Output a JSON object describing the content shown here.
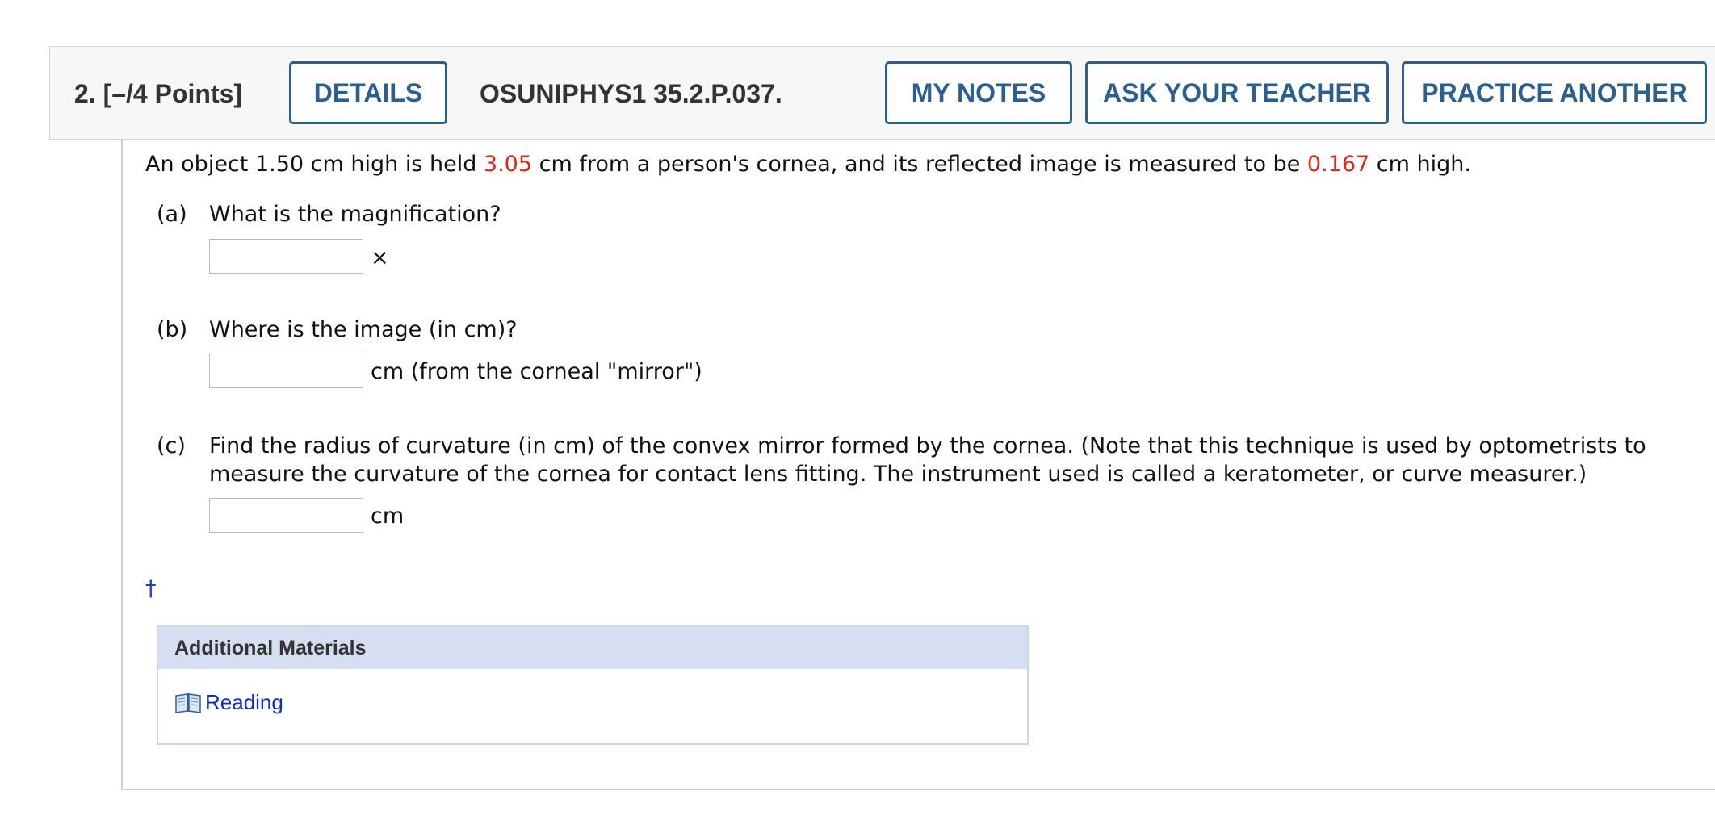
{
  "header": {
    "question_number": "2.",
    "points": "[–/4 Points]",
    "details_label": "DETAILS",
    "problem_code": "OSUNIPHYS1 35.2.P.037.",
    "my_notes_label": "MY NOTES",
    "ask_teacher_label": "ASK YOUR TEACHER",
    "practice_another_label": "PRACTICE ANOTHER"
  },
  "problem": {
    "statement_part1": "An object 1.50 cm high is held ",
    "value1": "3.05",
    "statement_part2": " cm from a person's cornea, and its reflected image is measured to be ",
    "value2": "0.167",
    "statement_part3": " cm high.",
    "highlight_color": "#e3261c"
  },
  "parts": [
    {
      "label": "(a)",
      "question": "What is the magnification?",
      "answer_value": "",
      "unit": "×"
    },
    {
      "label": "(b)",
      "question": "Where is the image (in cm)?",
      "answer_value": "",
      "unit": "cm (from the corneal \"mirror\")"
    },
    {
      "label": "(c)",
      "question_line1": "Find the radius of curvature (in cm) of the convex mirror formed by the cornea. (Note that this technique is used by optometrists to",
      "question_line2": "measure the curvature of the cornea for contact lens fitting. The instrument used is called a keratometer, or curve measurer.)",
      "answer_value": "",
      "unit": "cm"
    }
  ],
  "footnote_symbol": "†",
  "additional_materials": {
    "title": "Additional Materials",
    "link_icon": "book-icon",
    "link_label": "Reading"
  }
}
